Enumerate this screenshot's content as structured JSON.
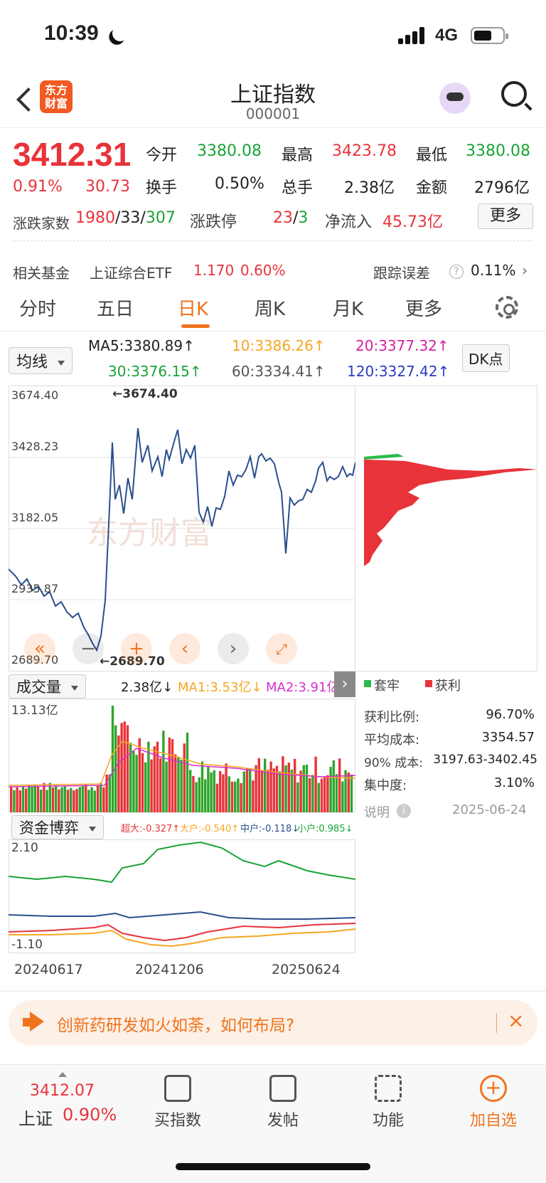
{
  "status": {
    "time": "10:39",
    "network": "4G"
  },
  "header": {
    "title": "上证指数",
    "code": "000001",
    "logo_text": "东方\n财富"
  },
  "quote": {
    "price": "3412.31",
    "pct": "0.91%",
    "change": "30.73",
    "open_label": "今开",
    "open": "3380.08",
    "high_label": "最高",
    "high": "3423.78",
    "low_label": "最低",
    "low": "3380.08",
    "turnover_label": "换手",
    "turnover": "0.50%",
    "volume_label": "总手",
    "volume": "2.38亿",
    "amount_label": "金额",
    "amount": "2796亿",
    "breadth_label": "涨跌家数",
    "breadth_up": "1980",
    "breadth_flat": "33",
    "breadth_down": "307",
    "limit_label": "涨跌停",
    "limit_up": "23",
    "limit_down": "3",
    "inflow_label": "净流入",
    "inflow": "45.73亿",
    "more_button": "更多"
  },
  "fund_row": {
    "label": "相关基金",
    "fund_name": "上证综合ETF",
    "fund_price": "1.170",
    "fund_pct": "0.60%",
    "tracking_label": "跟踪误差",
    "tracking_value": "0.11%"
  },
  "tabs": [
    "分时",
    "五日",
    "日K",
    "周K",
    "月K",
    "更多"
  ],
  "active_tab": "日K",
  "ma": {
    "selector": "均线",
    "ma5": "MA5:3380.89↑",
    "ma10": "10:3386.26↑",
    "ma20": "20:3377.32↑",
    "ma30": "30:3376.15↑",
    "ma60": "60:3334.41↑",
    "ma120": "120:3327.42↑",
    "dk_button": "DK点"
  },
  "price_chart": {
    "y_labels": [
      "3674.40",
      "3428.23",
      "3182.05",
      "2935.87",
      "2689.70"
    ],
    "max_marker": "←3674.40",
    "min_marker": "←2689.70",
    "watermark": "东方财富",
    "line_color": "#2b4f8e"
  },
  "volume": {
    "selector": "成交量",
    "value": "2.38亿↓",
    "ma1": "MA1:3.53亿↓",
    "ma2": "MA2:3.91亿↓",
    "y_max": "13.13亿"
  },
  "chip": {
    "legend_trapped": "套牢",
    "legend_profit": "获利",
    "rows": [
      {
        "label": "获利比例:",
        "value": "96.70%"
      },
      {
        "label": "平均成本:",
        "value": "3354.57"
      },
      {
        "label": "90% 成本:",
        "value": "3197.63-3402.45"
      },
      {
        "label": "集中度:",
        "value": "3.10%"
      }
    ],
    "note_label": "说明",
    "date": "2025-06-24"
  },
  "capital": {
    "selector": "资金博弈",
    "super_large": "超大:-0.327↑",
    "large": "大户:-0.540↑",
    "medium": "中户:-0.118↓",
    "small": "小户:0.985↓",
    "y_top": "2.10",
    "y_bottom": "-1.10",
    "dates": [
      "20240617",
      "20241206",
      "20250624"
    ]
  },
  "banner": {
    "text": "创新药研发如火如荼，如何布局?"
  },
  "bottom": {
    "index_price": "3412.07",
    "index_name": "上证",
    "index_pct": "0.90%",
    "nav": [
      "买指数",
      "发帖",
      "功能",
      "加自选"
    ]
  }
}
